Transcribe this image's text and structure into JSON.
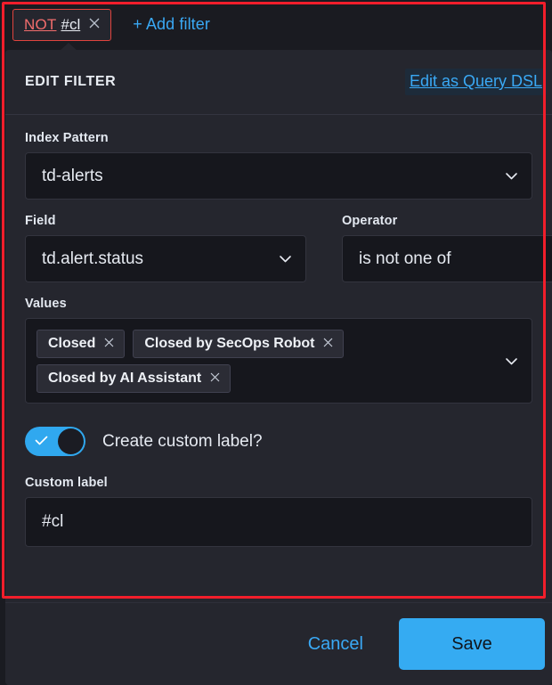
{
  "filter_bar": {
    "pill": {
      "negation": "NOT",
      "label": "#cl",
      "remove_icon": "close-icon"
    },
    "add_filter_label": "+ Add filter"
  },
  "popover": {
    "title": "EDIT FILTER",
    "dsl_link_label": "Edit as Query DSL",
    "index_pattern": {
      "label": "Index Pattern",
      "value": "td-alerts"
    },
    "field": {
      "label": "Field",
      "value": "td.alert.status"
    },
    "operator": {
      "label": "Operator",
      "value": "is not one of"
    },
    "values": {
      "label": "Values",
      "pills": [
        "Closed",
        "Closed by SecOps Robot",
        "Closed by AI Assistant"
      ]
    },
    "custom_label_toggle": {
      "label": "Create custom label?",
      "checked": true
    },
    "custom_label": {
      "label": "Custom label",
      "value": "#cl"
    },
    "footer": {
      "cancel_label": "Cancel",
      "save_label": "Save"
    }
  },
  "colors": {
    "accent": "#35abf2",
    "negation": "#f26d6d",
    "annotation": "#f21e2b",
    "panel_bg": "#25262e",
    "input_bg": "#16171d"
  }
}
